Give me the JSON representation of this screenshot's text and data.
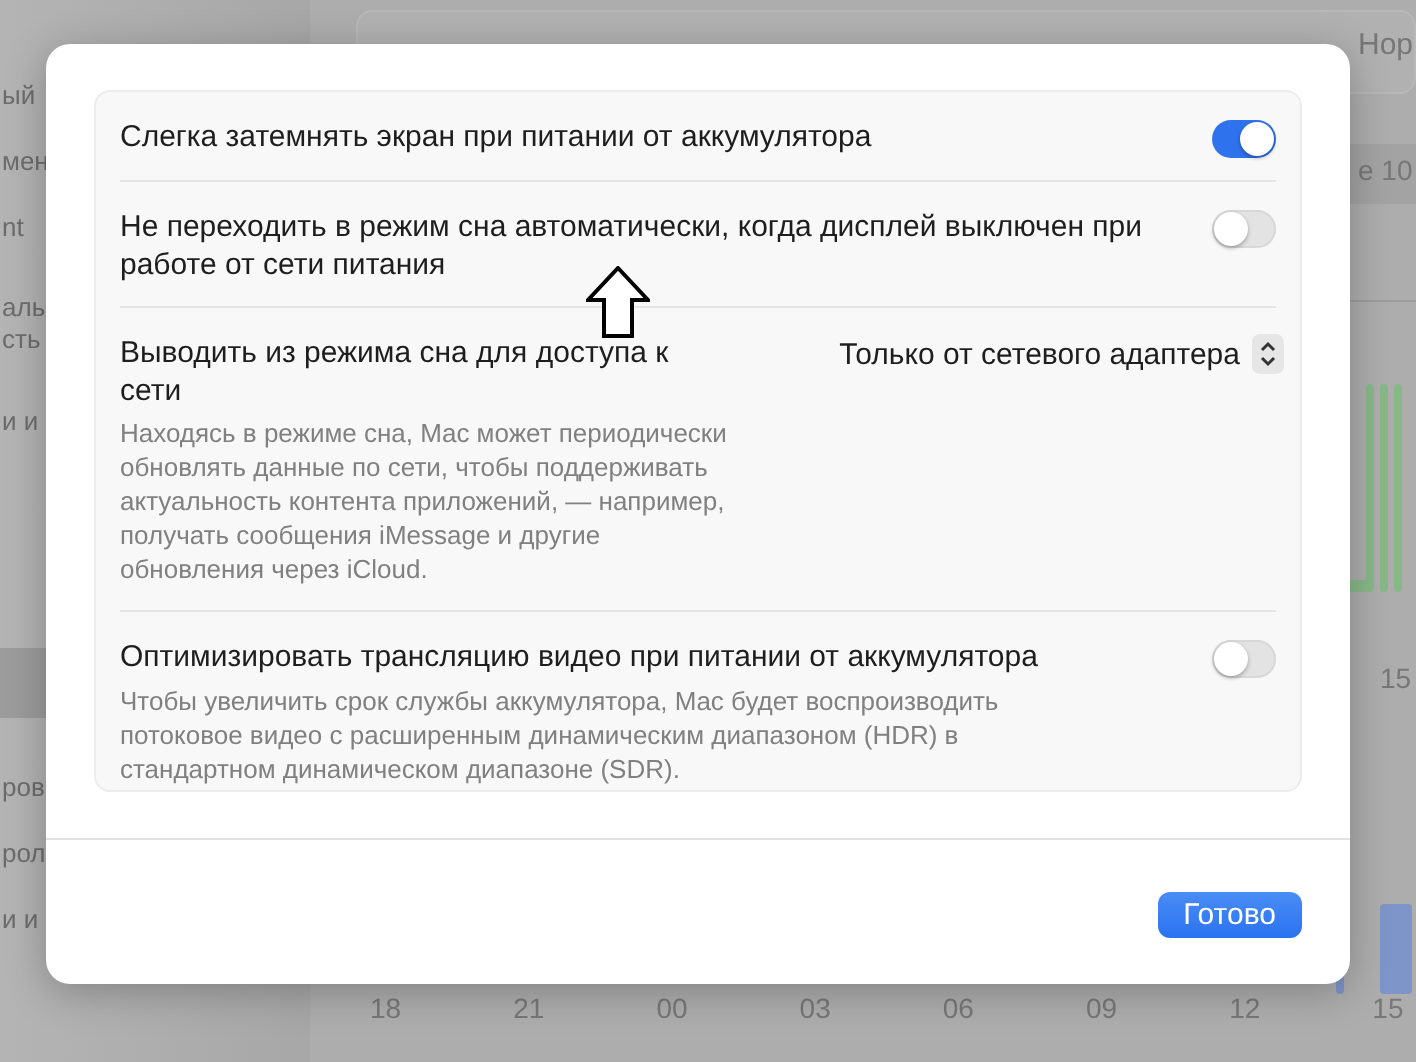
{
  "background": {
    "sidebar": {
      "sections": [
        [
          {
            "label": "ый",
            "selected": false
          },
          {
            "label": "мен",
            "selected": false
          },
          {
            "label": "nt",
            "selected": false
          },
          {
            "label": "аль\nсть",
            "selected": false
          },
          {
            "label": "и и",
            "selected": false
          }
        ],
        [
          {
            "selected": true
          },
          {
            "label": "ров",
            "selected": false
          },
          {
            "label": "рол",
            "selected": false
          },
          {
            "label": "и и",
            "selected": false
          }
        ]
      ]
    },
    "header_fragment": "Нор",
    "row_fragment": "е 10",
    "chart_tick_labels": [
      "15"
    ],
    "axis_labels": [
      "18",
      "21",
      "00",
      "03",
      "06",
      "09",
      "12",
      "15"
    ]
  },
  "dialog": {
    "settings": [
      {
        "kind": "toggle",
        "label": "Слегка затемнять экран при питании от аккумулятора",
        "on": true
      },
      {
        "kind": "toggle",
        "label": "Не переходить в режим сна автоматически, когда дисплей выключен при работе от сети питания",
        "on": false
      },
      {
        "kind": "popup",
        "label": "Выводить из режима сна для доступа к сети",
        "description": "Находясь в режиме сна, Mac может периодически обновлять данные по сети, чтобы поддерживать актуальность контента приложений, — например, получать сообщения iMessage и другие обновления через iCloud.",
        "value": "Только от сетевого адаптера"
      },
      {
        "kind": "toggle",
        "label": "Оптимизировать трансляцию видео при питании от аккумулятора",
        "description": "Чтобы увеличить срок службы аккумулятора, Mac будет воспроизводить потоковое видео с расширенным динамическим диапазоном (HDR) в стандартном динамическом диапазоне (SDR).",
        "on": false
      }
    ],
    "button": "Готово"
  }
}
